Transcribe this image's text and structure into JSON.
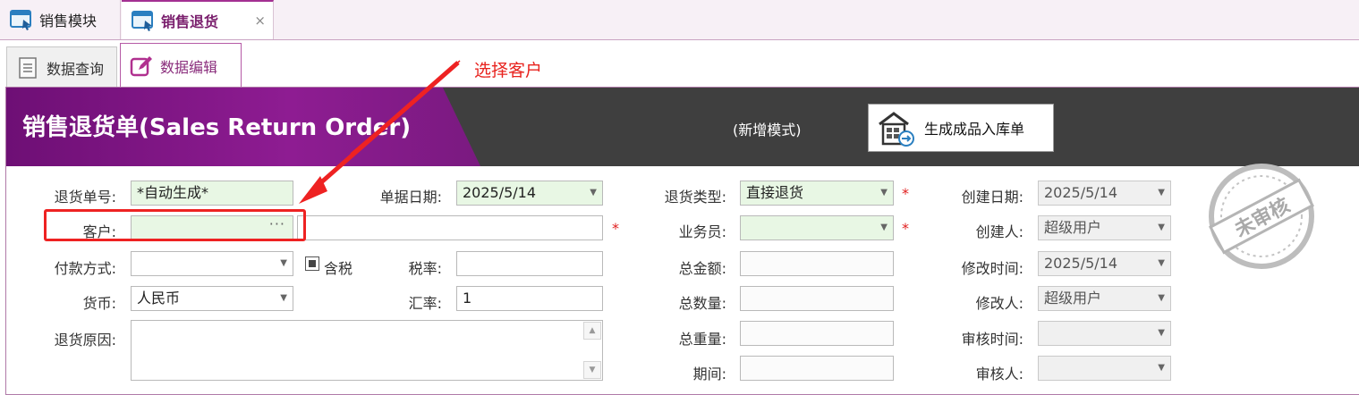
{
  "tabs": [
    {
      "label": "销售模块",
      "active": false
    },
    {
      "label": "销售退货",
      "active": true
    }
  ],
  "close_glyph": "×",
  "subtabs": [
    {
      "label": "数据查询",
      "icon": "document-icon",
      "active": false
    },
    {
      "label": "数据编辑",
      "icon": "edit-icon",
      "active": true
    }
  ],
  "annotation": {
    "text": "选择客户",
    "color": "#e8231e"
  },
  "banner": {
    "title": "销售退货单(Sales Return Order)",
    "mode": "(新增模式)",
    "generate_button": "生成成品入库单"
  },
  "form": {
    "return_no": {
      "label": "退货单号:",
      "value": "*自动生成*"
    },
    "customer": {
      "label": "客户:",
      "value": "",
      "name_value": ""
    },
    "payment": {
      "label": "付款方式:",
      "value": ""
    },
    "tax_included": {
      "label": "含税",
      "checked": true
    },
    "tax_rate": {
      "label": "税率:",
      "value": ""
    },
    "currency": {
      "label": "货币:",
      "value": "人民币"
    },
    "exchange_rate": {
      "label": "汇率:",
      "value": "1"
    },
    "reason": {
      "label": "退货原因:",
      "value": ""
    },
    "doc_date": {
      "label": "单据日期:",
      "value": "2025/5/14"
    },
    "return_type": {
      "label": "退货类型:",
      "value": "直接退货"
    },
    "salesperson": {
      "label": "业务员:",
      "value": ""
    },
    "total_amount": {
      "label": "总金额:",
      "value": ""
    },
    "total_qty": {
      "label": "总数量:",
      "value": ""
    },
    "total_weight": {
      "label": "总重量:",
      "value": ""
    },
    "period": {
      "label": "期间:",
      "value": ""
    },
    "created_date": {
      "label": "创建日期:",
      "value": "2025/5/14"
    },
    "creator": {
      "label": "创建人:",
      "value": "超级用户"
    },
    "modified_time": {
      "label": "修改时间:",
      "value": "2025/5/14"
    },
    "modifier": {
      "label": "修改人:",
      "value": "超级用户"
    },
    "audit_time": {
      "label": "审核时间:",
      "value": ""
    },
    "auditor": {
      "label": "审核人:",
      "value": ""
    }
  },
  "required_mark": "*",
  "stamp": {
    "text": "未审核"
  },
  "colors": {
    "accent": "#8e1c92",
    "required": "#e02020",
    "banner_dark": "#3f3f3f"
  }
}
